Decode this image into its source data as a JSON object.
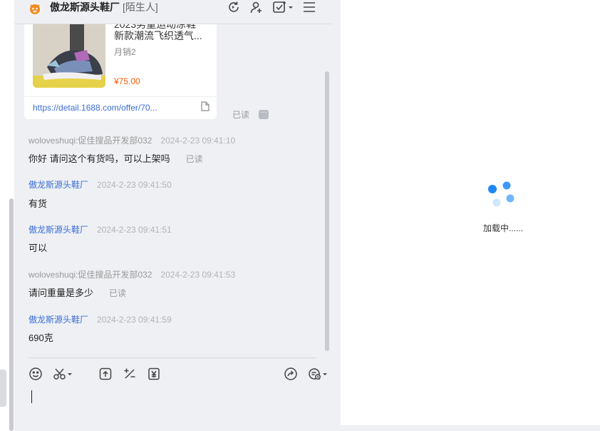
{
  "header": {
    "title": "傲龙斯源头鞋厂",
    "tag": "[陌生人]",
    "icons": [
      "refresh-icon",
      "add-contact-icon",
      "task-check-icon",
      "menu-icon"
    ]
  },
  "product_card": {
    "title_line1": "2023男童运动凉鞋",
    "title_line2": "新款潮流飞织透气...",
    "sales": "月销2",
    "price": "¥75.00",
    "link": "https://detail.1688.com/offer/70...",
    "read_status": "已读"
  },
  "messages": [
    {
      "sender": "woloveshuqi:促佳搜品开发部032",
      "time": "2024-2-23 09:41:10",
      "text": "你好 请问这个有货吗，可以上架吗",
      "read": "已读",
      "from_seller": false
    },
    {
      "sender": "傲龙斯源头鞋厂",
      "time": "2024-2-23 09:41:50",
      "text": "有货",
      "read": "",
      "from_seller": true
    },
    {
      "sender": "傲龙斯源头鞋厂",
      "time": "2024-2-23 09:41:51",
      "text": "可以",
      "read": "",
      "from_seller": true
    },
    {
      "sender": "woloveshuqi:促佳搜品开发部032",
      "time": "2024-2-23 09:41:53",
      "text": "请问重量是多少",
      "read": "已读",
      "from_seller": false
    },
    {
      "sender": "傲龙斯源头鞋厂",
      "time": "2024-2-23 09:41:59",
      "text": "690克",
      "read": "",
      "from_seller": true
    }
  ],
  "toolbar": {
    "icons": [
      "emoji-icon",
      "scissors-icon",
      "upload-icon",
      "discount-icon",
      "yuan-icon",
      "share-icon",
      "chat-history-icon"
    ]
  },
  "right_panel": {
    "loading_text": "加载中......"
  },
  "colors": {
    "seller_name": "#3b6fd6",
    "price": "#ff5b00",
    "spinner": "#1e88f5"
  }
}
